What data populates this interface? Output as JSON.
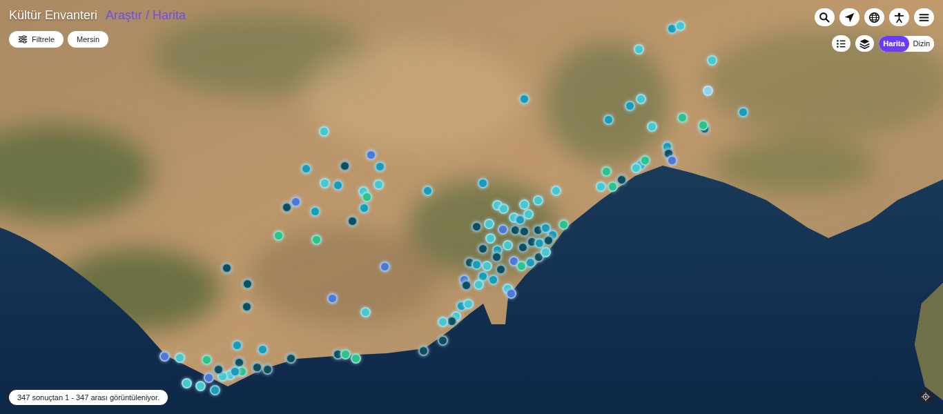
{
  "app": {
    "title": "Kültür Envanteri",
    "section": "Araştır / Harita"
  },
  "filters": {
    "button": "Filtrele",
    "chips": [
      {
        "label": "Mersin"
      }
    ]
  },
  "view_toggle": [
    {
      "label": "Harita",
      "selected": true
    },
    {
      "label": "Dizin",
      "selected": false
    }
  ],
  "status_bar": "347 sonuçtan 1 - 347 arası görüntüleniyor.",
  "pins": [
    {
      "x": 71.2,
      "y": 6.8,
      "color": "#1b9bb5"
    },
    {
      "x": 72.1,
      "y": 6.2,
      "color": "#46c8cc"
    },
    {
      "x": 67.7,
      "y": 11.8,
      "color": "#46c8cc"
    },
    {
      "x": 75.5,
      "y": 14.5,
      "color": "#46c8cc"
    },
    {
      "x": 75.0,
      "y": 21.8,
      "color": "#8fd3ee"
    },
    {
      "x": 78.8,
      "y": 27.0,
      "color": "#1b9bb5"
    },
    {
      "x": 66.8,
      "y": 25.5,
      "color": "#1b9bb5"
    },
    {
      "x": 67.9,
      "y": 23.8,
      "color": "#46c8cc"
    },
    {
      "x": 69.1,
      "y": 30.5,
      "color": "#46c8cc"
    },
    {
      "x": 64.5,
      "y": 28.8,
      "color": "#1b9bb5"
    },
    {
      "x": 72.3,
      "y": 28.3,
      "color": "#2cc28a"
    },
    {
      "x": 74.7,
      "y": 31.0,
      "color": "#0e4f5e"
    },
    {
      "x": 74.5,
      "y": 30.2,
      "color": "#2cc28a"
    },
    {
      "x": 70.7,
      "y": 35.3,
      "color": "#1b9bb5"
    },
    {
      "x": 70.9,
      "y": 37.0,
      "color": "#0e4f5e"
    },
    {
      "x": 71.2,
      "y": 38.7,
      "color": "#4d78d4"
    },
    {
      "x": 67.9,
      "y": 39.7,
      "color": "#1b9bb5"
    },
    {
      "x": 68.4,
      "y": 38.7,
      "color": "#2cc28a"
    },
    {
      "x": 67.4,
      "y": 40.5,
      "color": "#46c8cc"
    },
    {
      "x": 65.9,
      "y": 43.3,
      "color": "#0e4f5e"
    },
    {
      "x": 64.3,
      "y": 41.3,
      "color": "#2cc28a"
    },
    {
      "x": 64.9,
      "y": 45.0,
      "color": "#2cc28a"
    },
    {
      "x": 63.7,
      "y": 45.0,
      "color": "#46c8cc"
    },
    {
      "x": 55.6,
      "y": 23.8,
      "color": "#1b9bb5"
    },
    {
      "x": 58.9,
      "y": 46.0,
      "color": "#46c8cc"
    },
    {
      "x": 57.0,
      "y": 48.3,
      "color": "#46c8cc"
    },
    {
      "x": 55.6,
      "y": 49.3,
      "color": "#46c8cc"
    },
    {
      "x": 51.2,
      "y": 44.2,
      "color": "#1b9bb5"
    },
    {
      "x": 45.3,
      "y": 46.0,
      "color": "#1b9bb5"
    },
    {
      "x": 34.3,
      "y": 31.7,
      "color": "#46c8cc"
    },
    {
      "x": 32.4,
      "y": 40.7,
      "color": "#1b9bb5"
    },
    {
      "x": 36.5,
      "y": 40.0,
      "color": "#0e4f5e"
    },
    {
      "x": 39.3,
      "y": 37.3,
      "color": "#4d78d4"
    },
    {
      "x": 40.3,
      "y": 40.2,
      "color": "#1b9bb5"
    },
    {
      "x": 34.4,
      "y": 44.2,
      "color": "#46c8cc"
    },
    {
      "x": 35.8,
      "y": 44.7,
      "color": "#1b9bb5"
    },
    {
      "x": 40.1,
      "y": 44.5,
      "color": "#46c8cc"
    },
    {
      "x": 38.5,
      "y": 46.2,
      "color": "#46c8cc"
    },
    {
      "x": 38.9,
      "y": 47.5,
      "color": "#2cc28a"
    },
    {
      "x": 38.6,
      "y": 50.2,
      "color": "#1b9bb5"
    },
    {
      "x": 37.3,
      "y": 53.3,
      "color": "#0e4f5e"
    },
    {
      "x": 33.4,
      "y": 51.0,
      "color": "#1b9bb5"
    },
    {
      "x": 30.4,
      "y": 50.0,
      "color": "#0e4f5e"
    },
    {
      "x": 31.3,
      "y": 48.7,
      "color": "#4d78d4"
    },
    {
      "x": 29.5,
      "y": 56.8,
      "color": "#2cc28a"
    },
    {
      "x": 33.5,
      "y": 57.8,
      "color": "#2cc28a"
    },
    {
      "x": 40.8,
      "y": 64.3,
      "color": "#4d78d4"
    },
    {
      "x": 24.0,
      "y": 64.7,
      "color": "#0e4f5e"
    },
    {
      "x": 26.2,
      "y": 68.5,
      "color": "#0e4f5e"
    },
    {
      "x": 26.1,
      "y": 74.0,
      "color": "#0e4f5e"
    },
    {
      "x": 35.2,
      "y": 72.0,
      "color": "#4d78d4"
    },
    {
      "x": 38.7,
      "y": 75.3,
      "color": "#46c8cc"
    },
    {
      "x": 52.7,
      "y": 49.5,
      "color": "#46c8cc"
    },
    {
      "x": 53.4,
      "y": 50.3,
      "color": "#46c8cc"
    },
    {
      "x": 54.5,
      "y": 52.5,
      "color": "#46c8cc"
    },
    {
      "x": 55.1,
      "y": 53.0,
      "color": "#1b9bb5"
    },
    {
      "x": 56.0,
      "y": 51.7,
      "color": "#46c8cc"
    },
    {
      "x": 50.5,
      "y": 54.7,
      "color": "#0e4f5e"
    },
    {
      "x": 51.8,
      "y": 54.0,
      "color": "#46c8cc"
    },
    {
      "x": 53.3,
      "y": 55.3,
      "color": "#4d78d4"
    },
    {
      "x": 54.6,
      "y": 55.5,
      "color": "#0e4f5e"
    },
    {
      "x": 55.6,
      "y": 55.8,
      "color": "#0e4f5e"
    },
    {
      "x": 57.0,
      "y": 55.5,
      "color": "#0e4f5e"
    },
    {
      "x": 57.8,
      "y": 55.0,
      "color": "#1b9bb5"
    },
    {
      "x": 58.6,
      "y": 56.7,
      "color": "#1b9bb5"
    },
    {
      "x": 59.7,
      "y": 54.2,
      "color": "#2cc28a"
    },
    {
      "x": 52.0,
      "y": 57.5,
      "color": "#46c8cc"
    },
    {
      "x": 53.8,
      "y": 59.2,
      "color": "#46c8cc"
    },
    {
      "x": 55.4,
      "y": 59.7,
      "color": "#0e4f5e"
    },
    {
      "x": 56.4,
      "y": 58.3,
      "color": "#0e4f5e"
    },
    {
      "x": 57.2,
      "y": 58.7,
      "color": "#1b9bb5"
    },
    {
      "x": 58.1,
      "y": 58.0,
      "color": "#0e4f5e"
    },
    {
      "x": 51.2,
      "y": 60.0,
      "color": "#0e4f5e"
    },
    {
      "x": 52.7,
      "y": 60.3,
      "color": "#1b9bb5"
    },
    {
      "x": 54.5,
      "y": 63.0,
      "color": "#4d78d4"
    },
    {
      "x": 55.3,
      "y": 64.2,
      "color": "#2cc28a"
    },
    {
      "x": 56.2,
      "y": 63.3,
      "color": "#1b9bb5"
    },
    {
      "x": 57.1,
      "y": 62.0,
      "color": "#0e4f5e"
    },
    {
      "x": 57.8,
      "y": 60.8,
      "color": "#46c8cc"
    },
    {
      "x": 49.8,
      "y": 63.3,
      "color": "#0e4f5e"
    },
    {
      "x": 50.5,
      "y": 63.8,
      "color": "#1b9bb5"
    },
    {
      "x": 51.6,
      "y": 64.2,
      "color": "#46c8cc"
    },
    {
      "x": 52.6,
      "y": 62.0,
      "color": "#0e4f5e"
    },
    {
      "x": 53.1,
      "y": 65.0,
      "color": "#0e4f5e"
    },
    {
      "x": 51.2,
      "y": 66.7,
      "color": "#1b9bb5"
    },
    {
      "x": 50.7,
      "y": 68.7,
      "color": "#46c8cc"
    },
    {
      "x": 49.2,
      "y": 67.5,
      "color": "#4d78d4"
    },
    {
      "x": 49.4,
      "y": 68.8,
      "color": "#0e4f5e"
    },
    {
      "x": 53.8,
      "y": 69.7,
      "color": "#46c8cc"
    },
    {
      "x": 54.2,
      "y": 70.8,
      "color": "#4d78d4"
    },
    {
      "x": 52.3,
      "y": 67.5,
      "color": "#1b9bb5"
    },
    {
      "x": 48.9,
      "y": 73.8,
      "color": "#1b9bb5"
    },
    {
      "x": 49.6,
      "y": 73.3,
      "color": "#46c8cc"
    },
    {
      "x": 48.3,
      "y": 76.3,
      "color": "#46c8cc"
    },
    {
      "x": 47.9,
      "y": 77.5,
      "color": "#0e4f5e"
    },
    {
      "x": 46.9,
      "y": 77.7,
      "color": "#46c8cc"
    },
    {
      "x": 46.9,
      "y": 82.2,
      "color": "#0e4f5e"
    },
    {
      "x": 44.9,
      "y": 84.7,
      "color": "#0e4f5e"
    },
    {
      "x": 35.8,
      "y": 85.5,
      "color": "#0e4f5e"
    },
    {
      "x": 36.6,
      "y": 85.5,
      "color": "#2cc28a"
    },
    {
      "x": 37.7,
      "y": 86.5,
      "color": "#2cc28a"
    },
    {
      "x": 30.8,
      "y": 86.5,
      "color": "#0e4f5e"
    },
    {
      "x": 27.8,
      "y": 84.3,
      "color": "#1b9bb5"
    },
    {
      "x": 28.3,
      "y": 89.2,
      "color": "#0e4f5e"
    },
    {
      "x": 27.2,
      "y": 88.7,
      "color": "#0e4f5e"
    },
    {
      "x": 25.1,
      "y": 83.3,
      "color": "#1b9bb5"
    },
    {
      "x": 25.3,
      "y": 87.5,
      "color": "#0e4f5e"
    },
    {
      "x": 25.6,
      "y": 89.7,
      "color": "#2cc28a"
    },
    {
      "x": 24.4,
      "y": 90.5,
      "color": "#46c8cc"
    },
    {
      "x": 23.6,
      "y": 90.8,
      "color": "#46c8cc"
    },
    {
      "x": 23.1,
      "y": 89.2,
      "color": "#0e4f5e"
    },
    {
      "x": 21.9,
      "y": 86.8,
      "color": "#2cc28a"
    },
    {
      "x": 22.1,
      "y": 91.2,
      "color": "#4d78d4"
    },
    {
      "x": 21.2,
      "y": 93.2,
      "color": "#46c8cc"
    },
    {
      "x": 19.8,
      "y": 92.5,
      "color": "#46c8cc"
    },
    {
      "x": 22.8,
      "y": 94.2,
      "color": "#1b9bb5"
    },
    {
      "x": 17.4,
      "y": 86.0,
      "color": "#4d78d4"
    },
    {
      "x": 19.0,
      "y": 86.3,
      "color": "#46c8cc"
    },
    {
      "x": 24.9,
      "y": 89.7,
      "color": "#1b9bb5"
    }
  ]
}
